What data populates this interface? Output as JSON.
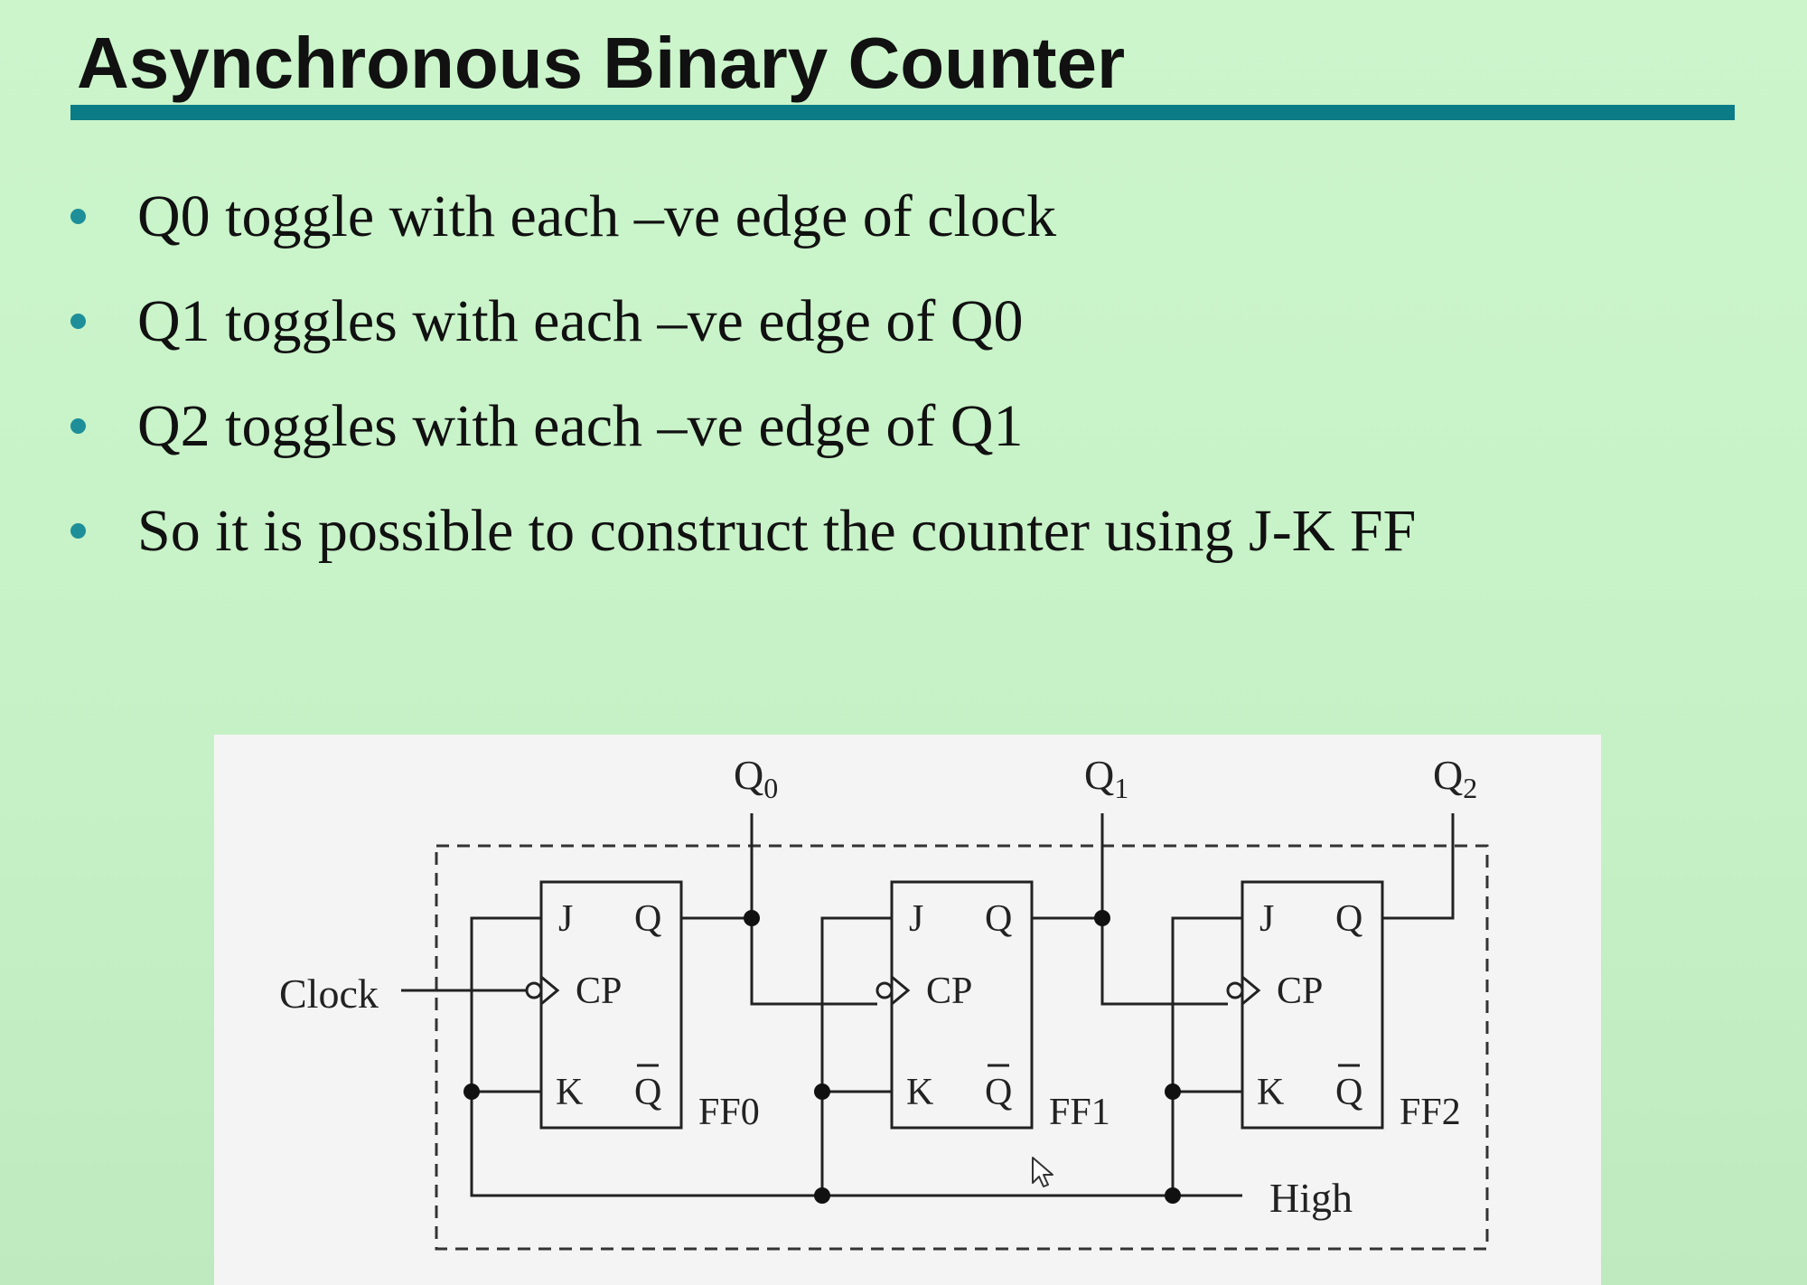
{
  "slide": {
    "title": "Asynchronous Binary Counter",
    "bullets": [
      "Q0 toggle with each –ve edge of clock",
      "Q1 toggles with each –ve edge of Q0",
      "Q2 toggles with each –ve edge of Q1",
      "So it is possible to construct the counter using J-K FF"
    ],
    "colors": {
      "background": "#ccf5cc",
      "title_rule": "#0b7c86",
      "bullet": "#1e8f99",
      "figure_background": "#f4f4f4"
    }
  },
  "circuit": {
    "outputs": [
      {
        "letter": "Q",
        "sub": "0"
      },
      {
        "letter": "Q",
        "sub": "1"
      },
      {
        "letter": "Q",
        "sub": "2"
      }
    ],
    "flipflops": [
      {
        "name": "FF0",
        "j": "J",
        "q": "Q",
        "cp": "CP",
        "k": "K",
        "qbar": "Q"
      },
      {
        "name": "FF1",
        "j": "J",
        "q": "Q",
        "cp": "CP",
        "k": "K",
        "qbar": "Q"
      },
      {
        "name": "FF2",
        "j": "J",
        "q": "Q",
        "cp": "CP",
        "k": "K",
        "qbar": "Q"
      }
    ],
    "clock_label": "Clock",
    "high_label": "High"
  }
}
